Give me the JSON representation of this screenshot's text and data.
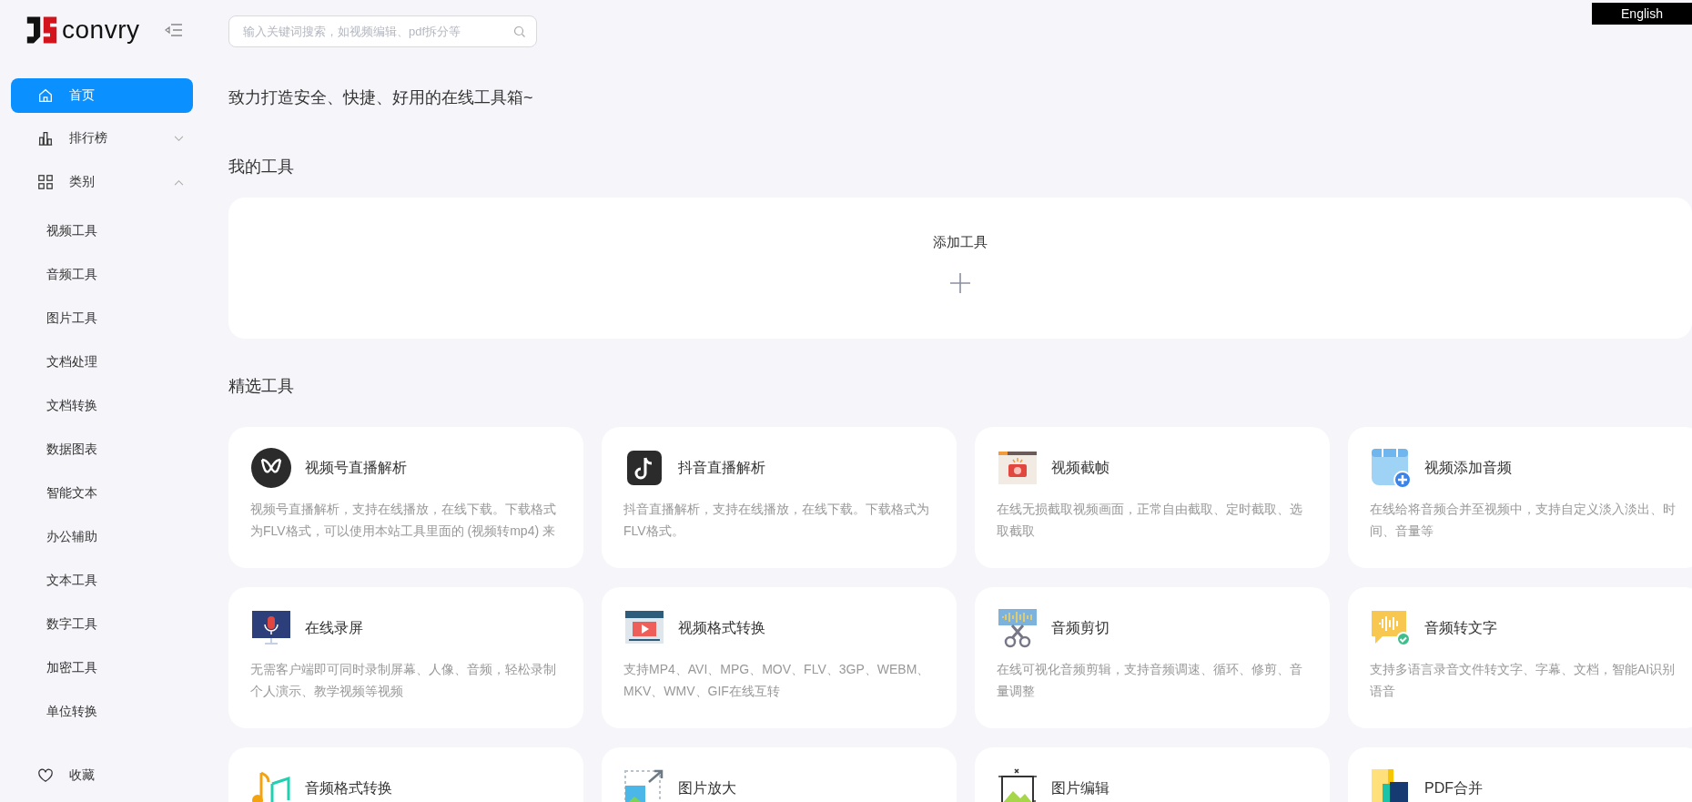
{
  "logo": {
    "text": "convry"
  },
  "search": {
    "placeholder": "输入关键词搜索，如视频编辑、pdf拆分等"
  },
  "language_button": "English",
  "sidebar": {
    "items": [
      {
        "label": "首页",
        "kind": "home",
        "selected": true
      },
      {
        "label": "排行榜",
        "kind": "ranking",
        "selected": false,
        "expanded": false
      },
      {
        "label": "类别",
        "kind": "category",
        "selected": false,
        "expanded": true,
        "children": [
          {
            "label": "视频工具",
            "selected": false
          },
          {
            "label": "音频工具",
            "selected": false
          },
          {
            "label": "图片工具",
            "selected": false
          },
          {
            "label": "文档处理",
            "selected": false
          },
          {
            "label": "文档转换",
            "selected": false
          },
          {
            "label": "数据图表",
            "selected": false
          },
          {
            "label": "智能文本",
            "selected": false
          },
          {
            "label": "办公辅助",
            "selected": false
          },
          {
            "label": "文本工具",
            "selected": false
          },
          {
            "label": "数字工具",
            "selected": false
          },
          {
            "label": "加密工具",
            "selected": false
          },
          {
            "label": "单位转换",
            "selected": false
          }
        ]
      },
      {
        "label": "收藏",
        "kind": "favorites",
        "selected": false
      }
    ]
  },
  "tagline": "致力打造安全、快捷、好用的在线工具箱~",
  "my_tools": {
    "heading": "我的工具",
    "add_label": "添加工具"
  },
  "featured": {
    "heading": "精选工具",
    "cards": [
      {
        "kind": "channels",
        "title": "视频号直播解析",
        "description": "视频号直播解析，支持在线播放，在线下载。下载格式为FLV格式，可以使用本站工具里面的 (视频转mp4) 来"
      },
      {
        "kind": "tiktok",
        "title": "抖音直播解析",
        "description": "抖音直播解析，支持在线播放，在线下载。下载格式为FLV格式。"
      },
      {
        "kind": "frame",
        "title": "视频截帧",
        "description": "在线无损截取视频画面，正常自由截取、定时截取、选取截取"
      },
      {
        "kind": "addaudio",
        "title": "视频添加音频",
        "description": "在线给将音频合并至视频中，支持自定义淡入淡出、时间、音量等"
      },
      {
        "kind": "record",
        "title": "在线录屏",
        "description": "无需客户端即可同时录制屏幕、人像、音频，轻松录制个人演示、教学视频等视频"
      },
      {
        "kind": "format",
        "title": "视频格式转换",
        "description": "支持MP4、AVI、MPG、MOV、FLV、3GP、WEBM、MKV、WMV、GIF在线互转"
      },
      {
        "kind": "cut",
        "title": "音频剪切",
        "description": "在线可视化音频剪辑，支持音频调速、循环、修剪、音量调整"
      },
      {
        "kind": "speech",
        "title": "音频转文字",
        "description": "支持多语言录音文件转文字、字幕、文档，智能AI识别语音"
      },
      {
        "kind": "music",
        "title": "音频格式转换"
      },
      {
        "kind": "enlarge",
        "title": "图片放大"
      },
      {
        "kind": "imgedit",
        "title": "图片编辑"
      },
      {
        "kind": "pdf",
        "title": "PDF合并"
      }
    ]
  }
}
